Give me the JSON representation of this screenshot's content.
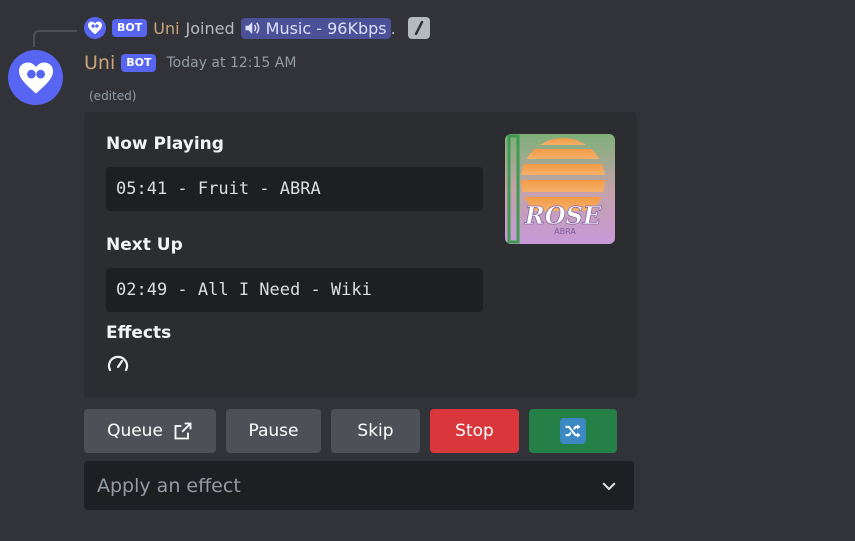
{
  "reply": {
    "bot_tag": "BOT",
    "name": "Uni",
    "action_text": "Joined",
    "channel": "Music - 96Kbps",
    "trailing": "."
  },
  "message": {
    "username": "Uni",
    "bot_tag": "BOT",
    "timestamp": "Today at 12:15 AM",
    "edited": "(edited)"
  },
  "embed": {
    "now_playing_label": "Now Playing",
    "now_playing_value": "05:41 - Fruit - ABRA",
    "next_up_label": "Next Up",
    "next_up_value": "02:49 - All I Need - Wiki",
    "effects_label": "Effects",
    "thumbnail_title": "ROSE",
    "thumbnail_artist": "ABRA"
  },
  "buttons": {
    "queue": "Queue",
    "pause": "Pause",
    "skip": "Skip",
    "stop": "Stop"
  },
  "select": {
    "placeholder": "Apply an effect"
  },
  "colors": {
    "blurple": "#5865f2",
    "danger": "#da373c",
    "success": "#248046",
    "secondary": "#4e5058"
  }
}
